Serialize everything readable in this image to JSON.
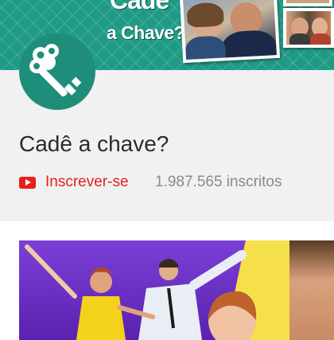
{
  "banner": {
    "title_line1": "Cadê",
    "title_line2": "a Chave?"
  },
  "channel": {
    "name": "Cadê a chave?",
    "subscribe_label": "Inscrever-se",
    "subscriber_count": "1.987.565 inscritos"
  },
  "colors": {
    "brand_teal": "#1e9a85",
    "subscribe_red": "#e62117"
  },
  "icons": {
    "avatar": "key-icon",
    "subscribe": "youtube-play-icon"
  }
}
